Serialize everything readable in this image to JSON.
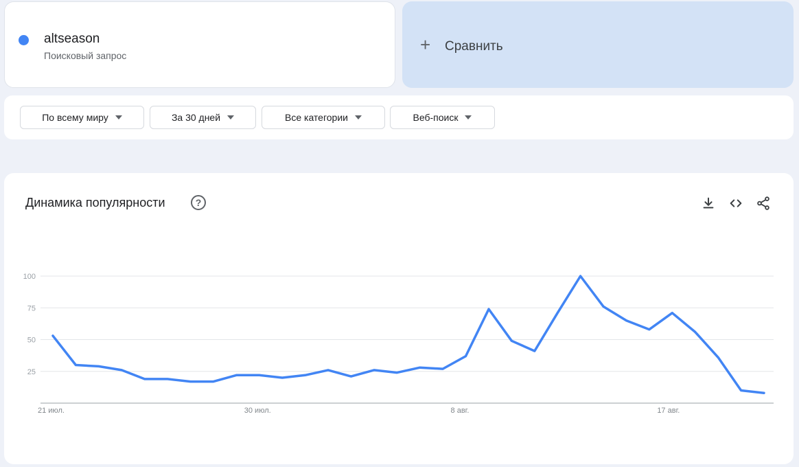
{
  "term": {
    "name": "altseason",
    "subtitle": "Поисковый запрос",
    "color": "#4285f4"
  },
  "compare": {
    "label": "Сравнить",
    "icon": "plus-icon"
  },
  "filters": [
    {
      "label": "По всему миру"
    },
    {
      "label": "За 30 дней"
    },
    {
      "label": "Все категории"
    },
    {
      "label": "Веб-поиск"
    }
  ],
  "chart_section": {
    "title": "Динамика популярности",
    "icons": [
      "help-icon",
      "download-icon",
      "embed-icon",
      "share-icon"
    ]
  },
  "chart_data": {
    "type": "line",
    "xlabel": "",
    "ylabel": "",
    "ylim": [
      0,
      100
    ],
    "yticks": [
      25,
      50,
      75,
      100
    ],
    "grid": true,
    "x_tick_labels": [
      {
        "index": 0,
        "label": "21 июл."
      },
      {
        "index": 9,
        "label": "30 июл."
      },
      {
        "index": 18,
        "label": "8 авг."
      },
      {
        "index": 27,
        "label": "17 авг."
      }
    ],
    "series": [
      {
        "color": "#4285f4",
        "values": [
          53,
          30,
          29,
          26,
          19,
          19,
          17,
          17,
          22,
          22,
          20,
          22,
          26,
          21,
          26,
          24,
          28,
          27,
          37,
          74,
          49,
          41,
          71,
          100,
          76,
          65,
          58,
          71,
          56,
          36,
          10,
          8
        ]
      }
    ]
  }
}
